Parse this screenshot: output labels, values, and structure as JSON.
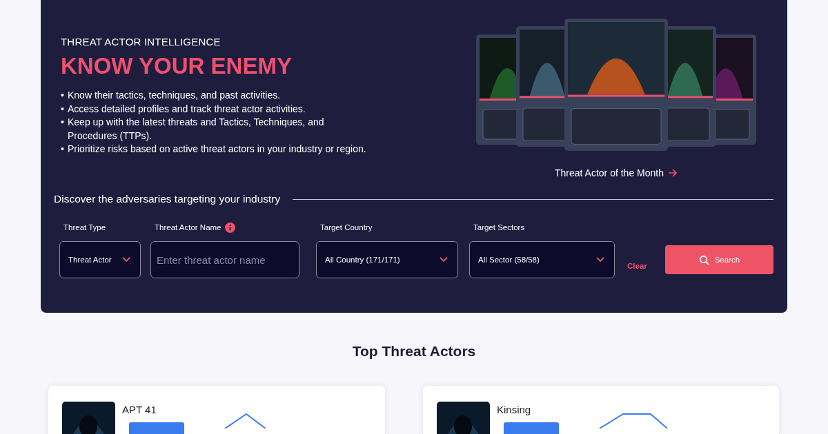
{
  "hero": {
    "eyebrow": "THREAT ACTOR INTELLIGENCE",
    "title": "KNOW YOUR ENEMY",
    "marker": "•",
    "bullets": [
      "Know their tactics, techniques, and past activities.",
      "Access detailed profiles and track threat actor activities.",
      "Keep up with the latest threats and Tactics, Techniques, and Procedures (TTPs).",
      "Prioritize risks based on active threat actors in your industry or region."
    ],
    "featured": {
      "kind": "picture",
      "link": "Threat Actor of the Month"
    }
  },
  "search": {
    "heading": "Discover the adversaries targeting your industry",
    "fields": [
      {
        "kind": "select",
        "label": "Threat Type",
        "value": "Threat Actor"
      },
      {
        "kind": "text",
        "label": "Threat Actor Name",
        "info": true,
        "placeholder": "Enter threat actor name"
      },
      {
        "kind": "select",
        "label": "Target Country",
        "value": "All Country (171/171)"
      },
      {
        "kind": "select",
        "label": "Target Sectors",
        "value": "All Sector (58/58)"
      }
    ],
    "clear": "Clear",
    "submit": "Search"
  },
  "top": {
    "title": "Top Threat Actors",
    "actors": [
      {
        "name": "APT 41"
      },
      {
        "name": "Kinsing"
      }
    ]
  }
}
